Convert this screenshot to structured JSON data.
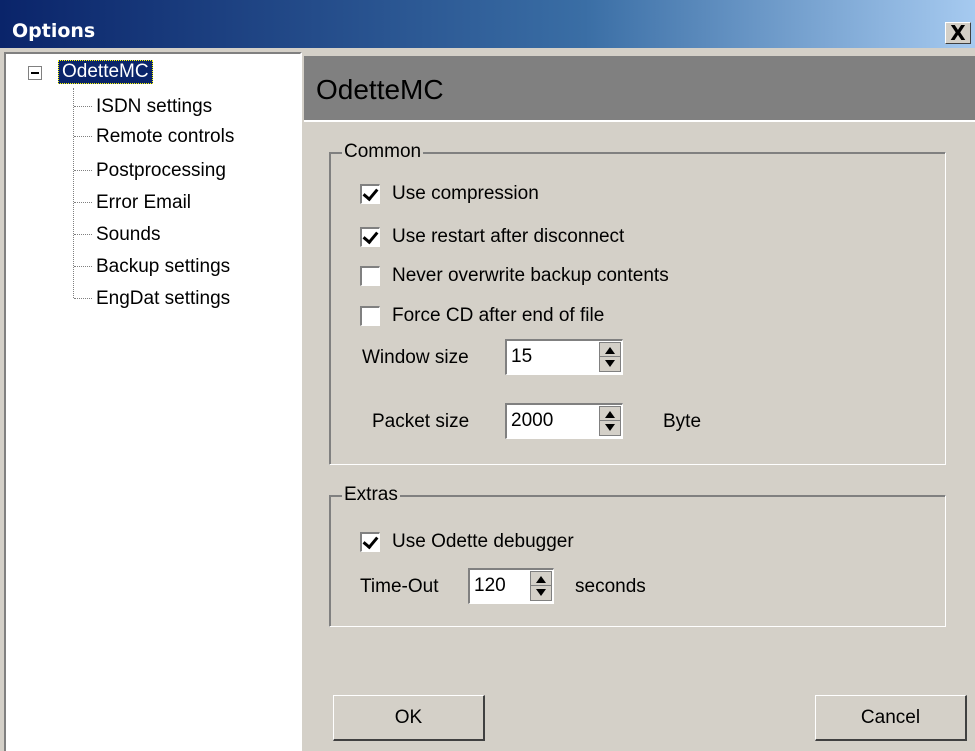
{
  "window": {
    "title": "Options",
    "close_glyph": "X"
  },
  "tree": {
    "root": "OdetteMC",
    "items": [
      "ISDN settings",
      "Remote controls",
      "Postprocessing",
      "Error Email",
      "Sounds",
      "Backup settings",
      "EngDat settings"
    ]
  },
  "header": {
    "title": "OdetteMC"
  },
  "common": {
    "legend": "Common",
    "checkboxes": [
      {
        "label": "Use compression",
        "checked": true
      },
      {
        "label": "Use restart after disconnect",
        "checked": true
      },
      {
        "label": "Never overwrite backup contents",
        "checked": false
      },
      {
        "label": "Force CD after end of file",
        "checked": false
      }
    ],
    "window_size": {
      "label": "Window size",
      "value": "15"
    },
    "packet_size": {
      "label": "Packet size",
      "value": "2000",
      "unit": "Byte"
    }
  },
  "extras": {
    "legend": "Extras",
    "debugger": {
      "label": "Use Odette debugger",
      "checked": true
    },
    "timeout": {
      "label": "Time-Out",
      "value": "120",
      "unit": "seconds"
    }
  },
  "buttons": {
    "ok": "OK",
    "cancel": "Cancel"
  },
  "colors": {
    "title_bar": "#0a246a",
    "header_bg": "#808080",
    "dialog_bg": "#d4d0c8"
  }
}
